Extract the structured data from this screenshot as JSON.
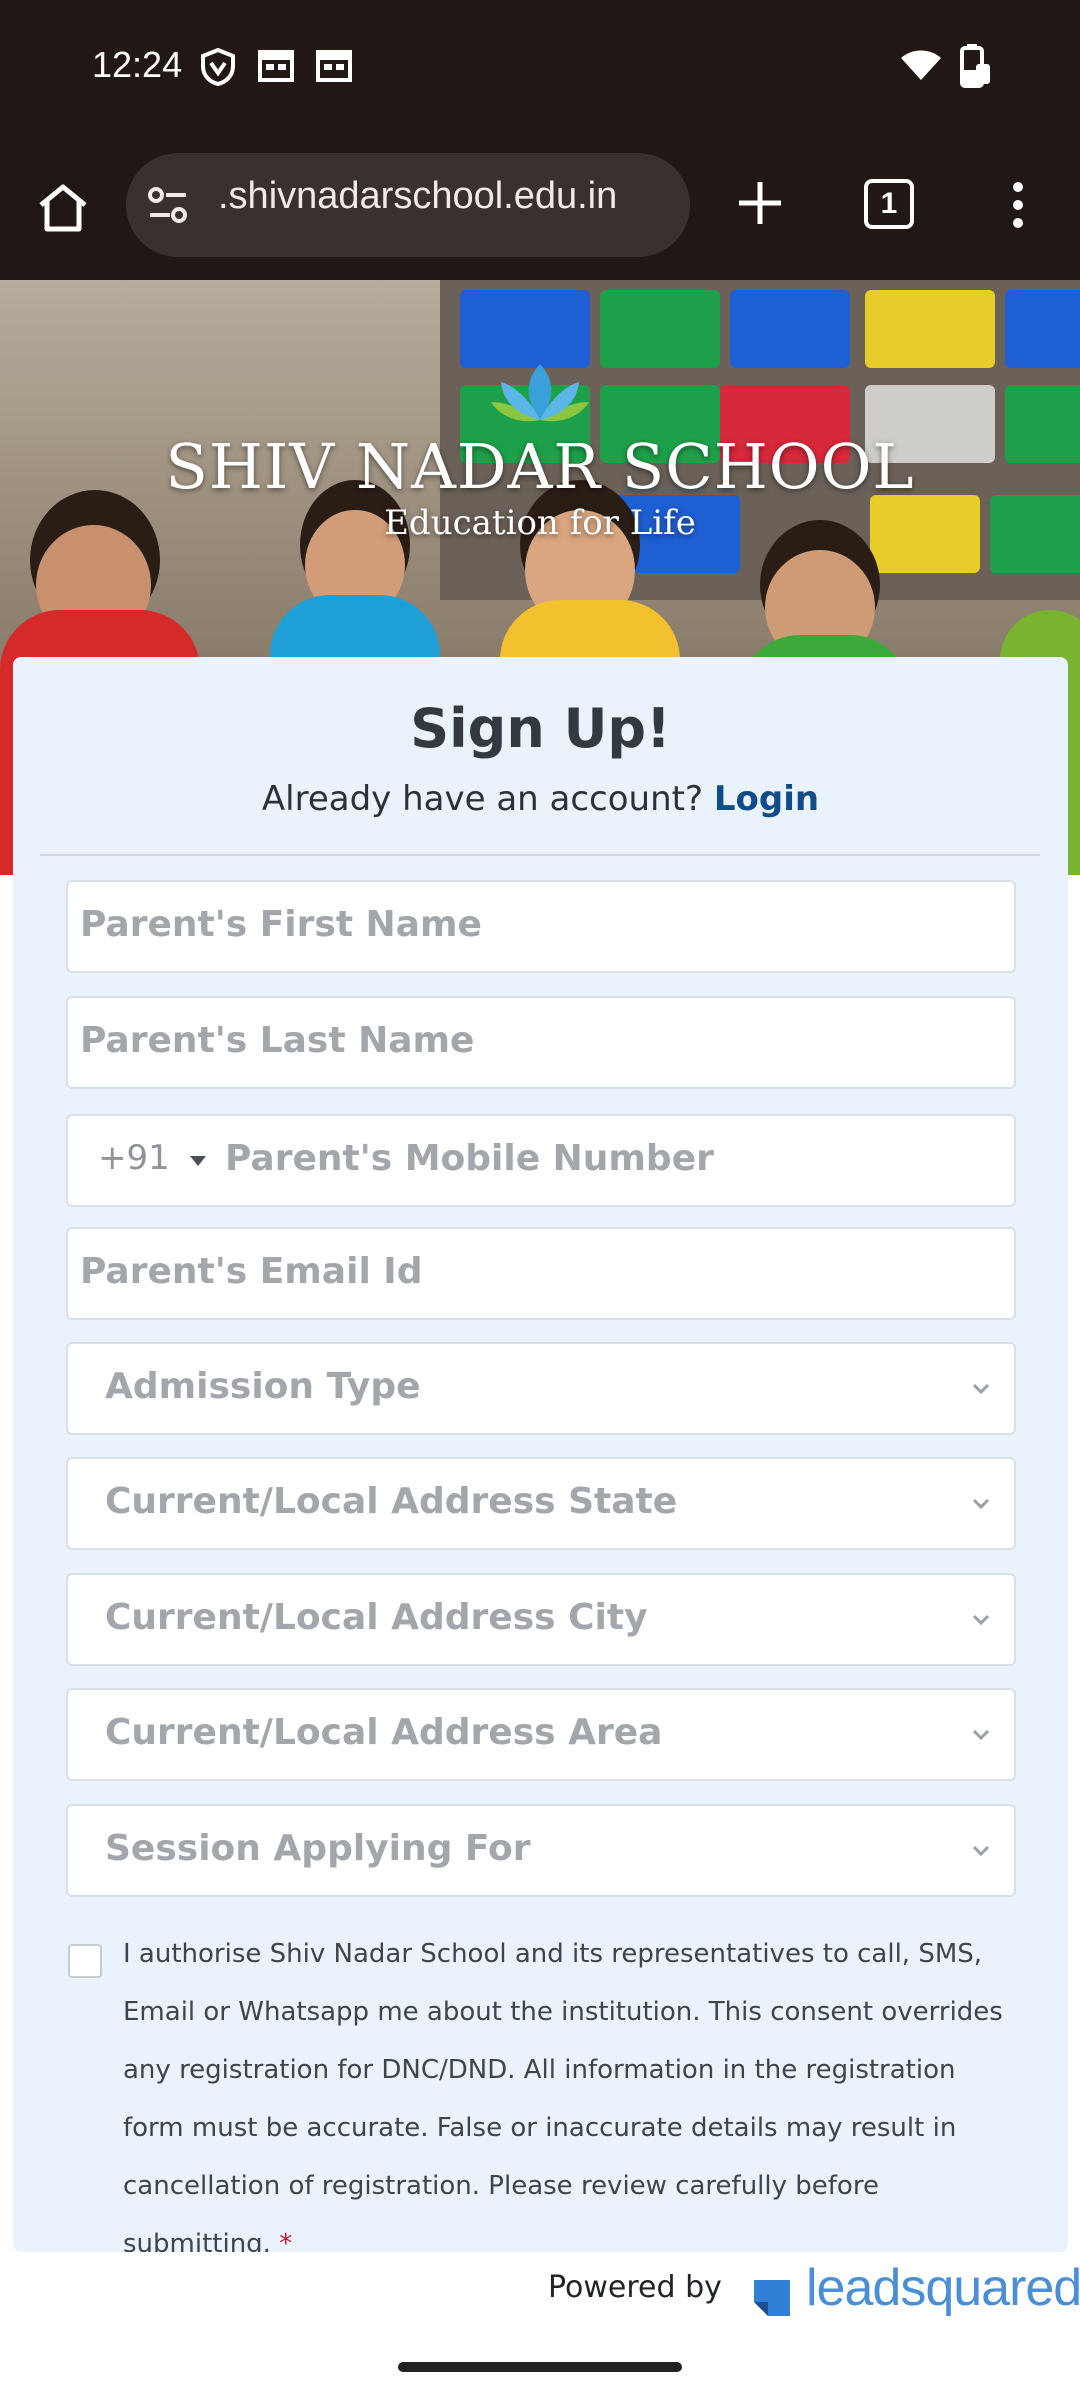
{
  "status_bar": {
    "time": "12:24"
  },
  "browser": {
    "url": ".shivnadarschool.edu.in",
    "tab_count": "1"
  },
  "hero": {
    "logo_title": "SHIV NADAR SCHOOL",
    "logo_subtitle": "Education for Life"
  },
  "form": {
    "title": "Sign Up!",
    "subtitle": "Already have an account?",
    "login_link": "Login",
    "fields": {
      "first_name": "Parent's First Name",
      "last_name": "Parent's Last Name",
      "country_code": "+91",
      "mobile": "Parent's Mobile Number",
      "email": "Parent's Email Id",
      "admission_type": "Admission Type",
      "state": "Current/Local Address State",
      "city": "Current/Local Address City",
      "area": "Current/Local Address Area",
      "session": "Session Applying For"
    },
    "consent": "I authorise Shiv Nadar School and its representatives to call, SMS, Email or Whatsapp me about the institution. This consent overrides any registration for DNC/DND. All information in the registration form must be accurate. False or inaccurate details may result in cancellation of registration. Please review carefully before submitting.",
    "required_mark": "*"
  },
  "footer": {
    "powered_by": "Powered by",
    "brand": "leadsquared"
  }
}
